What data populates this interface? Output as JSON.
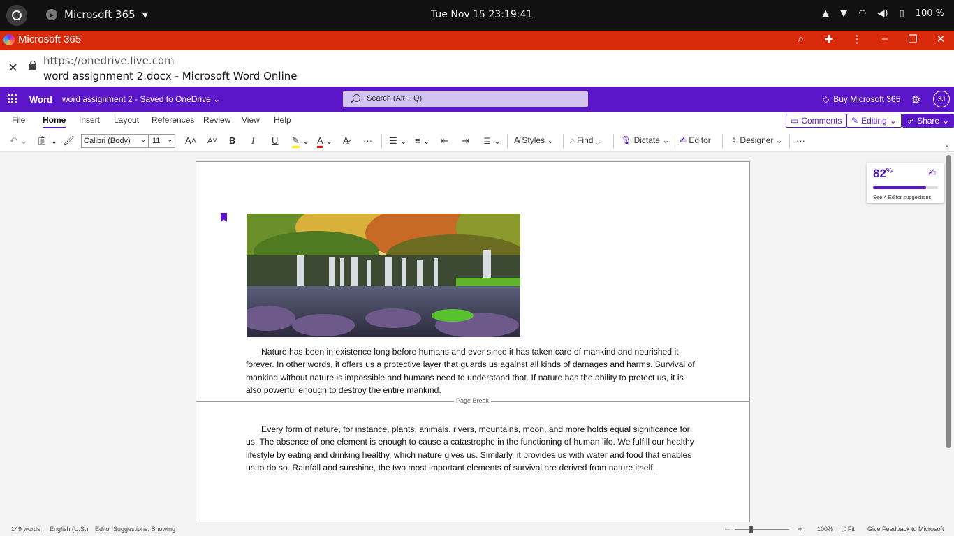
{
  "system": {
    "app_name": "Microsoft 365",
    "clock": "Tue Nov 15  23:19:41",
    "battery": "100 %"
  },
  "browser": {
    "title": "Microsoft 365",
    "domain": "https://onedrive.live.com",
    "page_title": "word assignment 2.docx - Microsoft Word Online"
  },
  "word": {
    "app": "Word",
    "doc_title": "word assignment 2  -  Saved to OneDrive",
    "search_placeholder": "Search (Alt + Q)",
    "buy": "Buy Microsoft 365",
    "avatar": "SJ"
  },
  "tabs": [
    "File",
    "Home",
    "Insert",
    "Layout",
    "References",
    "Review",
    "View",
    "Help"
  ],
  "actions": {
    "comments": "Comments",
    "editing": "Editing",
    "share": "Share"
  },
  "toolbar": {
    "font": "Calibri (Body)",
    "size": "11",
    "bold": "B",
    "italic": "I",
    "underline": "U",
    "styles": "Styles",
    "find": "Find",
    "dictate": "Dictate",
    "editor": "Editor",
    "designer": "Designer"
  },
  "document": {
    "paragraph1": "Nature has been in existence long before humans and ever since it has taken care of mankind and nourished it forever. In other words, it offers us a protective layer that guards us against all kinds of damages and harms. Survival of mankind without nature is impossible and humans need to understand that. If nature has the ability to protect us, it is also powerful enough to destroy the entire mankind.",
    "page_break": "Page Break",
    "paragraph2": "Every form of nature, for instance, plants, animals, rivers, mountains, moon, and more holds equal significance for us. The absence of one element is enough to cause a catastrophe in the functioning of human life. We fulfill our healthy lifestyle by eating and drinking healthy, which nature gives us. Similarly, it provides us with water and food that enables us to do so. Rainfall and sunshine, the two most important elements of survival are derived from nature itself."
  },
  "editor_card": {
    "score": "82",
    "pct": "%",
    "score_fraction": 0.82,
    "suggestions_prefix": "See ",
    "suggestions_count": "4",
    "suggestions_suffix": " Editor suggestions"
  },
  "status": {
    "words": "149 words",
    "language": "English (U.S.)",
    "editor_suggestions": "Editor Suggestions: Showing",
    "zoom": "100%",
    "fit": "Fit",
    "feedback": "Give Feedback to Microsoft"
  }
}
